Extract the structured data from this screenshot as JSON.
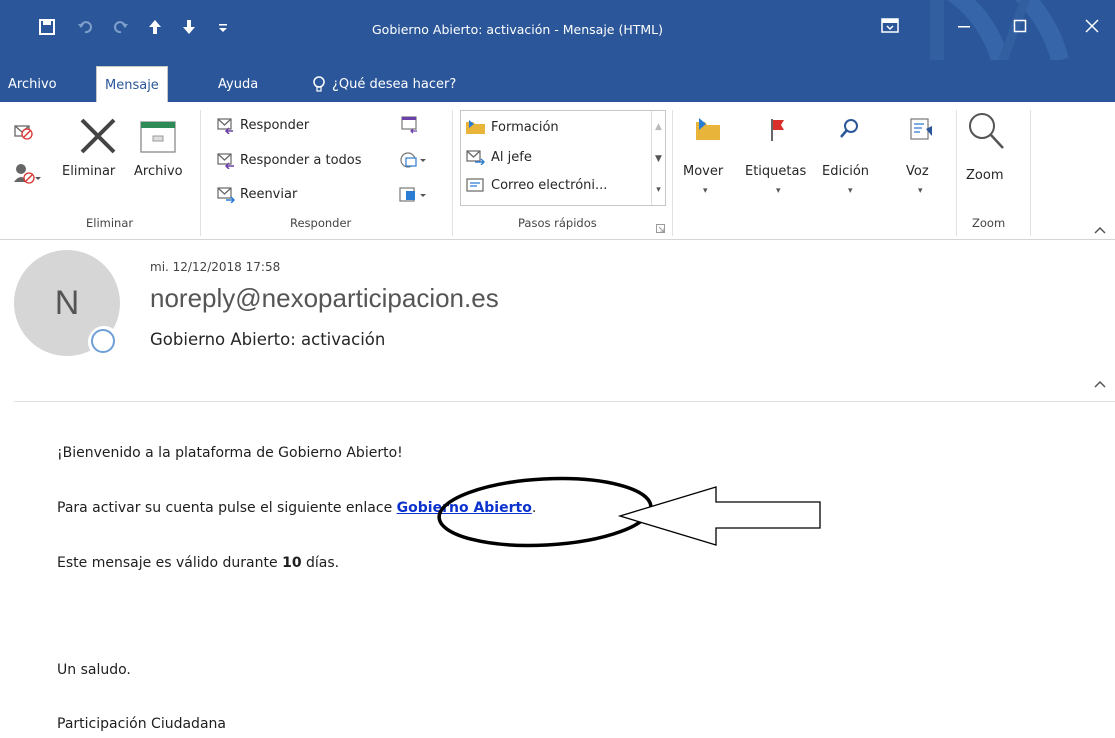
{
  "window": {
    "title": "Gobierno Abierto: activación  -  Mensaje (HTML)",
    "icons": [
      "save-icon",
      "undo-icon",
      "redo-icon",
      "up-arrow-icon",
      "down-arrow-icon",
      "customize-qat-icon",
      "ribbon-display-icon",
      "minimize-icon",
      "maximize-icon",
      "close-icon"
    ]
  },
  "tabs": {
    "archivo": "Archivo",
    "mensaje": "Mensaje",
    "ayuda": "Ayuda",
    "tell_me": "¿Qué desea hacer?"
  },
  "ribbon": {
    "eliminar": {
      "group_label": "Eliminar",
      "delete": "Eliminar",
      "archive": "Archivo"
    },
    "responder": {
      "group_label": "Responder",
      "reply": "Responder",
      "reply_all": "Responder a todos",
      "forward": "Reenviar"
    },
    "pasos_rapidos": {
      "group_label": "Pasos rápidos",
      "items": [
        "Formación",
        "Al jefe",
        "Correo electróni..."
      ]
    },
    "mover": {
      "label": "Mover"
    },
    "etiquetas": {
      "label": "Etiquetas"
    },
    "edicion": {
      "label": "Edición"
    },
    "voz": {
      "label": "Voz"
    },
    "zoom": {
      "label": "Zoom",
      "group_label": "Zoom"
    }
  },
  "message": {
    "date": "mi. 12/12/2018 17:58",
    "avatar_initial": "N",
    "from": "noreply@nexoparticipacion.es",
    "subject": "Gobierno Abierto: activación"
  },
  "body": {
    "welcome": "¡Bienvenido a la plataforma de Gobierno Abierto!",
    "activate_prefix": "Para activar su cuenta pulse el siguiente enlace ",
    "activate_link": "Gobierno Abierto",
    "activate_suffix": ".",
    "validity_prefix": "Este mensaje es válido durante ",
    "validity_days": "10",
    "validity_suffix": " días.",
    "greeting": "Un saludo.",
    "signature": "Participación Ciudadana"
  },
  "colors": {
    "title_bar": "#2b579a",
    "link": "#0b32cc",
    "flag": "#d9302c"
  }
}
